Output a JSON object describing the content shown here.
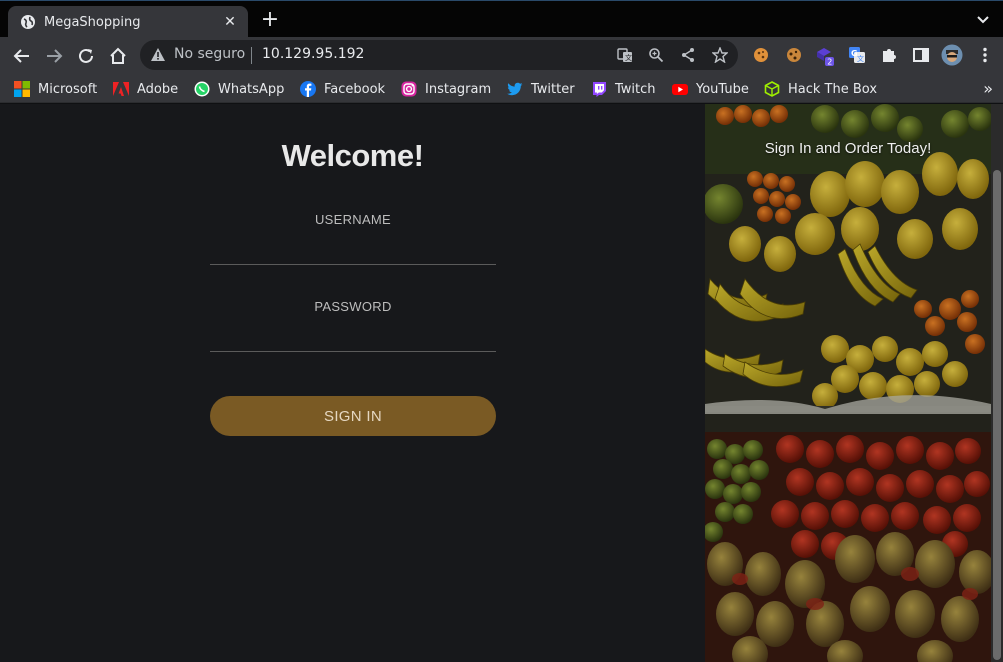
{
  "browser": {
    "tab_title": "MegaShopping",
    "security_label": "No seguro",
    "url": "10.129.95.192",
    "extension_badge": "2"
  },
  "bookmarks": [
    {
      "label": "Microsoft",
      "icon": "microsoft-icon"
    },
    {
      "label": "Adobe",
      "icon": "adobe-icon"
    },
    {
      "label": "WhatsApp",
      "icon": "whatsapp-icon"
    },
    {
      "label": "Facebook",
      "icon": "facebook-icon"
    },
    {
      "label": "Instagram",
      "icon": "instagram-icon"
    },
    {
      "label": "Twitter",
      "icon": "twitter-icon"
    },
    {
      "label": "Twitch",
      "icon": "twitch-icon"
    },
    {
      "label": "YouTube",
      "icon": "youtube-icon"
    },
    {
      "label": "Hack The Box",
      "icon": "hackthebox-icon"
    }
  ],
  "login": {
    "heading": "Welcome!",
    "username_label": "USERNAME",
    "password_label": "PASSWORD",
    "submit_label": "SIGN IN"
  },
  "promo": {
    "tagline": "Sign In and Order Today!"
  },
  "colors": {
    "page_bg": "#17181b",
    "button_bg": "#7a5a24",
    "toolbar_bg": "#35363a"
  }
}
